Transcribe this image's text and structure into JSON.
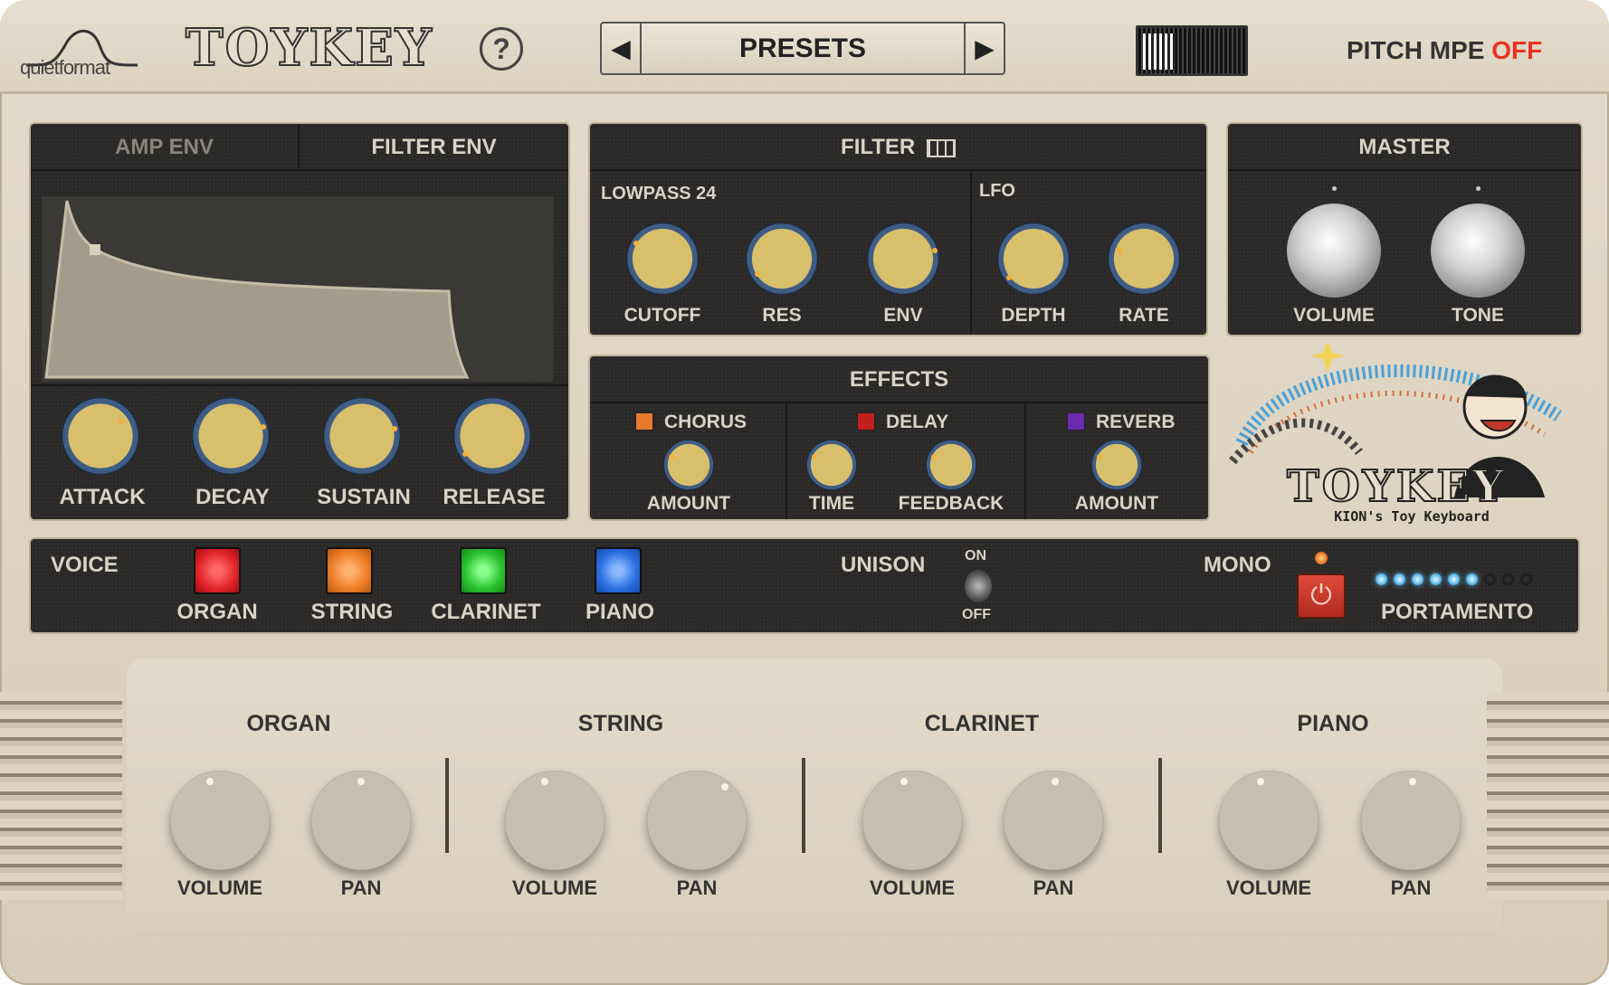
{
  "header": {
    "brand": "quietformat",
    "title": "TOYKEY",
    "help": "?",
    "presets": {
      "label": "PRESETS",
      "prev": "◀",
      "next": "▶"
    },
    "pitch_mpe": {
      "label": "PITCH MPE",
      "state": "OFF",
      "state_color": "#e63328"
    }
  },
  "env": {
    "tabs": [
      "AMP ENV",
      "FILTER ENV"
    ],
    "active_tab": "FILTER ENV",
    "knobs": [
      {
        "label": "ATTACK"
      },
      {
        "label": "DECAY"
      },
      {
        "label": "SUSTAIN"
      },
      {
        "label": "RELEASE"
      }
    ]
  },
  "filter": {
    "title": "FILTER",
    "mode": "LOWPASS 24",
    "lfo_label": "LFO",
    "knobs": [
      {
        "label": "CUTOFF"
      },
      {
        "label": "RES"
      },
      {
        "label": "ENV"
      },
      {
        "label": "DEPTH"
      },
      {
        "label": "RATE"
      }
    ]
  },
  "master": {
    "title": "MASTER",
    "knobs": [
      {
        "label": "VOLUME"
      },
      {
        "label": "TONE"
      }
    ]
  },
  "effects": {
    "title": "EFFECTS",
    "units": [
      {
        "name": "CHORUS",
        "color": "#e8782a",
        "knobs": [
          "AMOUNT"
        ]
      },
      {
        "name": "DELAY",
        "color": "#c0201f",
        "knobs": [
          "TIME",
          "FEEDBACK"
        ]
      },
      {
        "name": "REVERB",
        "color": "#6b2bb0",
        "knobs": [
          "AMOUNT"
        ]
      }
    ]
  },
  "artwork": {
    "title": "TOYKEY",
    "subtitle": "KION's Toy Keyboard"
  },
  "voice": {
    "label": "VOICE",
    "buttons": [
      {
        "label": "ORGAN",
        "color": "#e2242a"
      },
      {
        "label": "STRING",
        "color": "#ee7d25"
      },
      {
        "label": "CLARINET",
        "color": "#29c32f"
      },
      {
        "label": "PIANO",
        "color": "#2b6fe0"
      }
    ],
    "unison": {
      "label": "UNISON",
      "on": "ON",
      "off": "OFF"
    },
    "mono": {
      "label": "MONO"
    },
    "portamento": {
      "label": "PORTAMENTO",
      "lit_leds": 6,
      "total_leds": 9
    }
  },
  "mixer": [
    {
      "name": "ORGAN",
      "knobs": [
        "VOLUME",
        "PAN"
      ]
    },
    {
      "name": "STRING",
      "knobs": [
        "VOLUME",
        "PAN"
      ]
    },
    {
      "name": "CLARINET",
      "knobs": [
        "VOLUME",
        "PAN"
      ]
    },
    {
      "name": "PIANO",
      "knobs": [
        "VOLUME",
        "PAN"
      ]
    }
  ]
}
